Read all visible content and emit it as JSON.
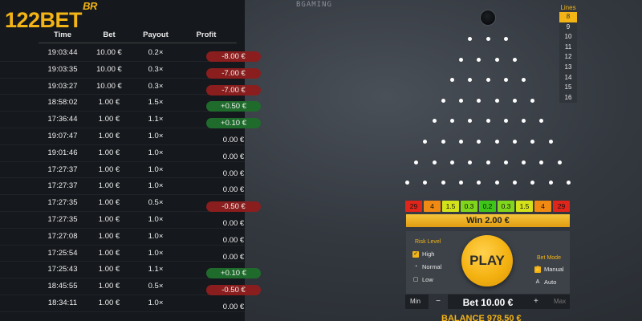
{
  "brand": {
    "name": "122BET",
    "suffix": "BR",
    "provider": "BGAMING"
  },
  "history": {
    "headers": {
      "time": "Time",
      "bet": "Bet",
      "payout": "Payout",
      "profit": "Profit"
    },
    "rows": [
      {
        "time": "19:03:44",
        "bet": "10.00 €",
        "payout": "0.2×",
        "profit": "-8.00 €",
        "kind": "neg"
      },
      {
        "time": "19:03:35",
        "bet": "10.00 €",
        "payout": "0.3×",
        "profit": "-7.00 €",
        "kind": "neg"
      },
      {
        "time": "19:03:27",
        "bet": "10.00 €",
        "payout": "0.3×",
        "profit": "-7.00 €",
        "kind": "neg"
      },
      {
        "time": "18:58:02",
        "bet": "1.00 €",
        "payout": "1.5×",
        "profit": "+0.50 €",
        "kind": "pos"
      },
      {
        "time": "17:36:44",
        "bet": "1.00 €",
        "payout": "1.1×",
        "profit": "+0.10 €",
        "kind": "pos"
      },
      {
        "time": "19:07:47",
        "bet": "1.00 €",
        "payout": "1.0×",
        "profit": "0.00 €",
        "kind": "zero"
      },
      {
        "time": "19:01:46",
        "bet": "1.00 €",
        "payout": "1.0×",
        "profit": "0.00 €",
        "kind": "zero"
      },
      {
        "time": "17:27:37",
        "bet": "1.00 €",
        "payout": "1.0×",
        "profit": "0.00 €",
        "kind": "zero"
      },
      {
        "time": "17:27:37",
        "bet": "1.00 €",
        "payout": "1.0×",
        "profit": "0.00 €",
        "kind": "zero"
      },
      {
        "time": "17:27:35",
        "bet": "1.00 €",
        "payout": "0.5×",
        "profit": "-0.50 €",
        "kind": "neg"
      },
      {
        "time": "17:27:35",
        "bet": "1.00 €",
        "payout": "1.0×",
        "profit": "0.00 €",
        "kind": "zero"
      },
      {
        "time": "17:27:08",
        "bet": "1.00 €",
        "payout": "1.0×",
        "profit": "0.00 €",
        "kind": "zero"
      },
      {
        "time": "17:25:54",
        "bet": "1.00 €",
        "payout": "1.0×",
        "profit": "0.00 €",
        "kind": "zero"
      },
      {
        "time": "17:25:43",
        "bet": "1.00 €",
        "payout": "1.1×",
        "profit": "+0.10 €",
        "kind": "pos"
      },
      {
        "time": "18:45:55",
        "bet": "1.00 €",
        "payout": "0.5×",
        "profit": "-0.50 €",
        "kind": "neg"
      },
      {
        "time": "18:34:11",
        "bet": "1.00 €",
        "payout": "1.0×",
        "profit": "0.00 €",
        "kind": "zero"
      }
    ]
  },
  "lines": {
    "label": "Lines",
    "options": [
      "8",
      "9",
      "10",
      "11",
      "12",
      "13",
      "14",
      "15",
      "16"
    ],
    "selected": "8"
  },
  "board": {
    "peg_rows": 8,
    "first_row_pegs": 3
  },
  "multipliers": [
    {
      "label": "29",
      "color": "#e0251b"
    },
    {
      "label": "4",
      "color": "#f08a12"
    },
    {
      "label": "1.5",
      "color": "#d4e21a"
    },
    {
      "label": "0.3",
      "color": "#7fd61a"
    },
    {
      "label": "0.2",
      "color": "#3fc41a"
    },
    {
      "label": "0.3",
      "color": "#7fd61a"
    },
    {
      "label": "1.5",
      "color": "#d4e21a"
    },
    {
      "label": "4",
      "color": "#f08a12"
    },
    {
      "label": "29",
      "color": "#e0251b"
    }
  ],
  "win": "Win 2.00 €",
  "risk": {
    "label": "Risk Level",
    "options": [
      {
        "label": "High",
        "icon": "check-icon",
        "selected": true
      },
      {
        "label": "Normal",
        "icon": "gauge-icon",
        "selected": false
      },
      {
        "label": "Low",
        "icon": "lock-icon",
        "selected": false
      }
    ]
  },
  "mode": {
    "label": "Bet Mode",
    "options": [
      {
        "label": "Manual",
        "icon": "manual-icon",
        "selected": true
      },
      {
        "label": "Auto",
        "icon": "auto-icon",
        "selected": false
      }
    ]
  },
  "play_label": "PLAY",
  "bet": {
    "min": "Min",
    "minus": "−",
    "value": "Bet 10.00 €",
    "plus": "+",
    "max": "Max"
  },
  "balance": "BALANCE 978.50 €",
  "colors": {
    "accent": "#f3b416",
    "negative": "#8a1e1e",
    "positive": "#1f6b2c"
  }
}
